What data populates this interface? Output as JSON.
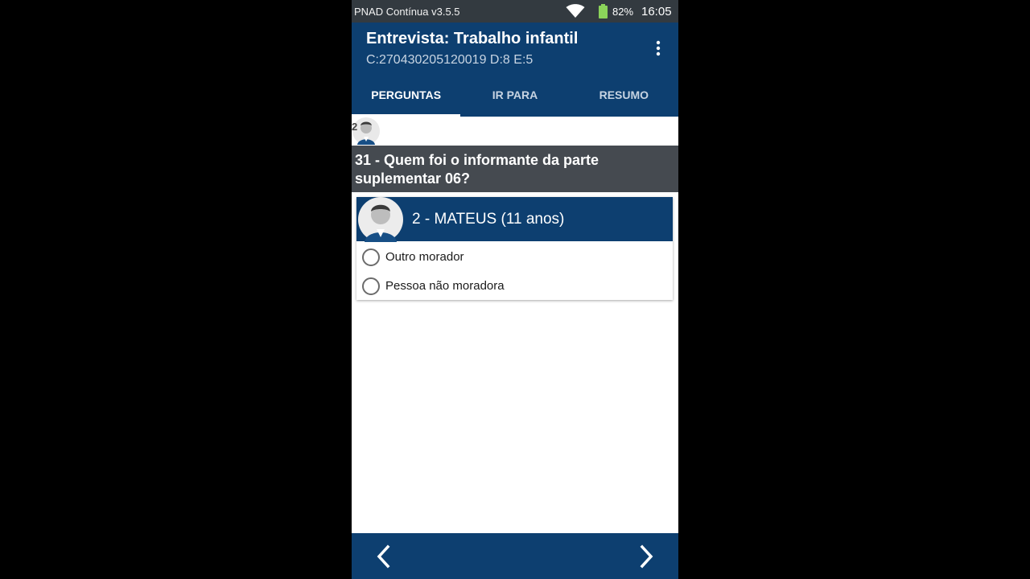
{
  "status_bar": {
    "app_label": "PNAD Contínua v3.5.5",
    "battery_percent": "82%",
    "time": "16:05",
    "wifi_icon": "wifi-icon",
    "battery_icon": "battery-icon"
  },
  "app_bar": {
    "title": "Entrevista: Trabalho infantil",
    "subtitle": "C:270430205120019 D:8 E:5",
    "menu_icon": "more-vert-icon"
  },
  "tabs": [
    {
      "label": "PERGUNTAS",
      "active": true
    },
    {
      "label": "IR PARA",
      "active": false
    },
    {
      "label": "RESUMO",
      "active": false
    }
  ],
  "strip": {
    "person_number": "2"
  },
  "question": {
    "text": "31 - Quem foi o informante da parte suplementar 06?"
  },
  "selected_person": {
    "label": "2 - MATEUS (11 anos)"
  },
  "options": [
    {
      "label": "Outro morador",
      "checked": false
    },
    {
      "label": "Pessoa não moradora",
      "checked": false
    }
  ],
  "navigation": {
    "prev_icon": "chevron-left-icon",
    "next_icon": "chevron-right-icon"
  },
  "colors": {
    "primary": "#0d3f70",
    "status_bar": "#333a40",
    "question_bg": "#454a50",
    "battery": "#8bd35a"
  }
}
